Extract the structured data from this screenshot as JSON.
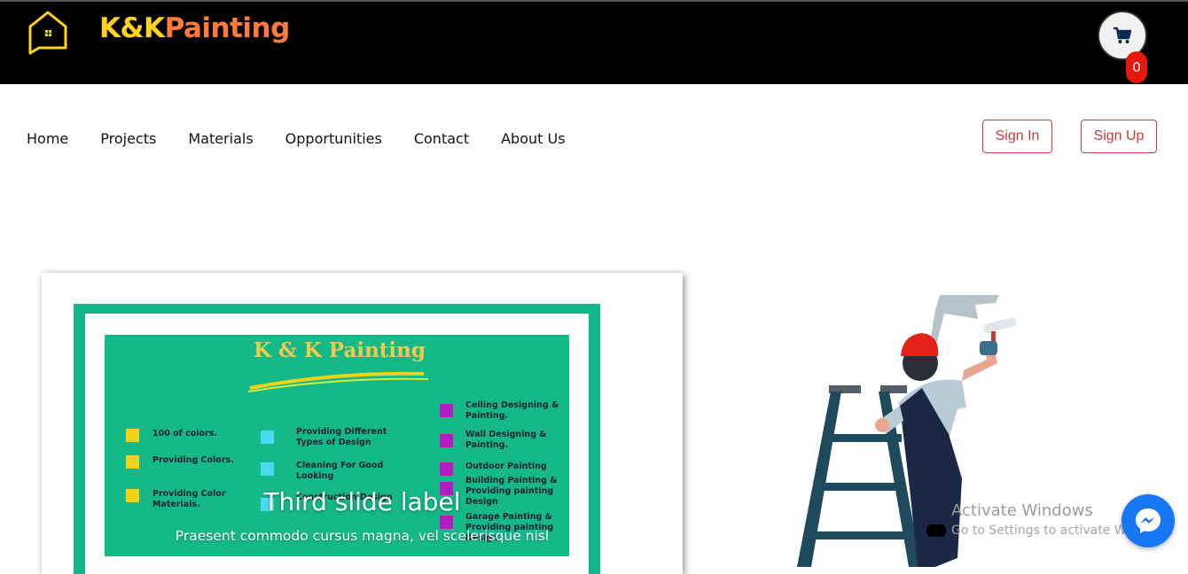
{
  "brand": {
    "part1": "K&K",
    "part2": "Painting"
  },
  "cart": {
    "count": "0"
  },
  "nav": {
    "items": [
      "Home",
      "Projects",
      "Materials",
      "Opportunities",
      "Contact",
      "About Us"
    ]
  },
  "auth": {
    "signin": "Sign In",
    "signup": "Sign Up"
  },
  "carousel": {
    "flyer_title": "K & K  Painting",
    "col1": [
      "100 of colors.",
      "Providing Colors.",
      "Providing Color Materials."
    ],
    "col2": [
      "Providing Different Types of Design",
      "Cleaning For Good Looking",
      "Construction Design"
    ],
    "col3": [
      "Ceiling Designing & Painting.",
      "Wall Designing & Painting.",
      "Outdoor Painting",
      "Building Painting & Providing painting Design",
      "Garage Painting & Providing painting Design"
    ],
    "caption_title": "Third slide label",
    "caption_text": "Praesent commodo cursus magna, vel scelerisque nisl"
  },
  "watermark": {
    "line1": "Activate Windows",
    "line2": "Go to Settings to activate Windows."
  },
  "colors": {
    "brand_yellow": "#ffd21f",
    "brand_orange": "#ff7a3c",
    "accent_red": "#c43a3a",
    "flyer_green": "#14b987",
    "messenger_blue": "#1877f2"
  }
}
